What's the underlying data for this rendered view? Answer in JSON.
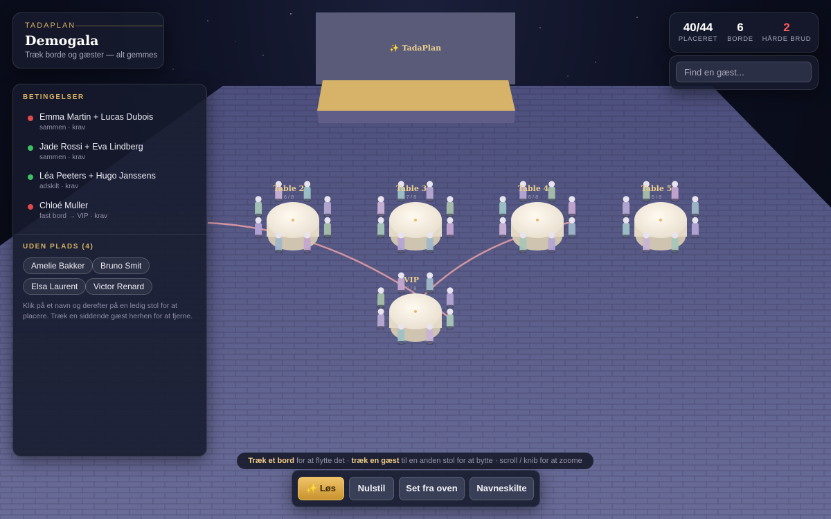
{
  "app": {
    "brand": "TADAPLAN",
    "event_name": "Demogala",
    "subtitle": "Træk borde og gæster — alt gemmes"
  },
  "stage": {
    "banner": "✨ TadaPlan"
  },
  "stats": [
    {
      "value": "40/44",
      "label": "PLACERET"
    },
    {
      "value": "6",
      "label": "BORDE"
    },
    {
      "value": "2",
      "label": "HÅRDE BRUD"
    }
  ],
  "search": {
    "placeholder": "Find en gæst..."
  },
  "constraints": {
    "title": "BETINGELSER",
    "items": [
      {
        "names": "Emma Martin + Lucas Dubois",
        "meta": "sammen · krav",
        "status": "violated",
        "color": "#e24a4a"
      },
      {
        "names": "Jade Rossi + Eva Lindberg",
        "meta": "sammen · krav",
        "status": "ok",
        "color": "#3fbf64"
      },
      {
        "names": "Léa Peeters + Hugo Janssens",
        "meta": "adskilt · krav",
        "status": "ok",
        "color": "#3fbf64"
      },
      {
        "names": "Chloé Muller",
        "meta": "fast bord → VIP · krav",
        "status": "violated",
        "color": "#e24a4a"
      }
    ]
  },
  "unseated": {
    "title": "UDEN PLADS (4)",
    "guests": [
      "Amelie Bakker",
      "Bruno Smit",
      "Elsa Laurent",
      "Victor Renard"
    ],
    "hint": "Klik på et navn og derefter på en ledig stol for at placere. Træk en siddende gæst herhen for at fjerne."
  },
  "tables": [
    {
      "name": "Table 2",
      "count": "6 / 8"
    },
    {
      "name": "Table 3",
      "count": "7 / 8"
    },
    {
      "name": "Table 4",
      "count": "6 / 8"
    },
    {
      "name": "Table 5",
      "count": "6 / 8"
    },
    {
      "name": "VIP",
      "count": "7 / 8"
    }
  ],
  "tip": {
    "part1": "Træk et bord",
    "part2": " for at flytte det · ",
    "part3": "træk en gæst",
    "part4": " til en anden stol for at bytte · scroll / knib for at zoome"
  },
  "toolbar": {
    "solve": "✨ Løs",
    "reset": "Nulstil",
    "top_view": "Set fra oven",
    "name_cards": "Navneskilte"
  },
  "colors": {
    "accent": "#d6b262",
    "violation": "#e24a4a",
    "ok": "#3fbf64",
    "floor": "#5a5b86"
  }
}
